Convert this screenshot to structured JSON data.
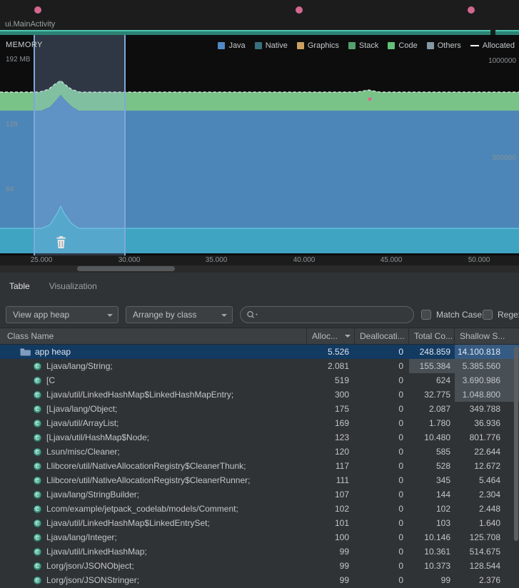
{
  "events_bar": {
    "activity_label": "ui.MainActivity"
  },
  "memory": {
    "title": "MEMORY",
    "max_memory_label": "192 MB",
    "y_axis_left": [
      "128",
      "64"
    ],
    "y_axis_right": [
      "1000000",
      "500000"
    ],
    "legend": [
      {
        "label": "Java",
        "color": "#5289c4"
      },
      {
        "label": "Native",
        "color": "#38707f"
      },
      {
        "label": "Graphics",
        "color": "#cba05f"
      },
      {
        "label": "Stack",
        "color": "#55a06f"
      },
      {
        "label": "Code",
        "color": "#64c17a"
      },
      {
        "label": "Others",
        "color": "#8497a5"
      },
      {
        "label": "Allocated",
        "color": "#ffffff",
        "line": true
      }
    ],
    "timeline_ticks": [
      "25.000",
      "30.000",
      "35.000",
      "40.000",
      "45.000",
      "50.000"
    ]
  },
  "tabs": [
    {
      "label": "Table",
      "active": true
    },
    {
      "label": "Visualization",
      "active": false
    }
  ],
  "controls": {
    "heap_select": "View app heap",
    "arrange_select": "Arrange by class",
    "search_placeholder": "",
    "match_case_label": "Match Case",
    "regex_label": "Regex"
  },
  "table": {
    "columns": [
      "Class Name",
      "Alloc...",
      "Deallocati...",
      "Total Co...",
      "Shallow S..."
    ],
    "sort_column_index": 1,
    "rows": [
      {
        "name": "app heap",
        "icon": "heap-folder",
        "indent": 0,
        "selected": true,
        "alloc": "5.526",
        "dealloc": "0",
        "total": "248.859",
        "shallow": "14.100.818",
        "hl_shallow": true
      },
      {
        "name": "Ljava/lang/String;",
        "icon": "class",
        "indent": 1,
        "alloc": "2.081",
        "dealloc": "0",
        "total": "155.384",
        "shallow": "5.385.560",
        "hl_total": true,
        "hl_shallow": true
      },
      {
        "name": "[C",
        "icon": "class",
        "indent": 1,
        "alloc": "519",
        "dealloc": "0",
        "total": "624",
        "shallow": "3.690.986",
        "hl_shallow": true
      },
      {
        "name": "Ljava/util/LinkedHashMap$LinkedHashMapEntry;",
        "icon": "class",
        "indent": 1,
        "alloc": "300",
        "dealloc": "0",
        "total": "32.775",
        "shallow": "1.048.800",
        "hl_shallow": true
      },
      {
        "name": "[Ljava/lang/Object;",
        "icon": "class",
        "indent": 1,
        "alloc": "175",
        "dealloc": "0",
        "total": "2.087",
        "shallow": "349.788"
      },
      {
        "name": "Ljava/util/ArrayList;",
        "icon": "class",
        "indent": 1,
        "alloc": "169",
        "dealloc": "0",
        "total": "1.780",
        "shallow": "36.936"
      },
      {
        "name": "[Ljava/util/HashMap$Node;",
        "icon": "class",
        "indent": 1,
        "alloc": "123",
        "dealloc": "0",
        "total": "10.480",
        "shallow": "801.776"
      },
      {
        "name": "Lsun/misc/Cleaner;",
        "icon": "class",
        "indent": 1,
        "alloc": "120",
        "dealloc": "0",
        "total": "585",
        "shallow": "22.644"
      },
      {
        "name": "Llibcore/util/NativeAllocationRegistry$CleanerThunk;",
        "icon": "class",
        "indent": 1,
        "alloc": "117",
        "dealloc": "0",
        "total": "528",
        "shallow": "12.672"
      },
      {
        "name": "Llibcore/util/NativeAllocationRegistry$CleanerRunner;",
        "icon": "class",
        "indent": 1,
        "alloc": "111",
        "dealloc": "0",
        "total": "345",
        "shallow": "5.464"
      },
      {
        "name": "Ljava/lang/StringBuilder;",
        "icon": "class",
        "indent": 1,
        "alloc": "107",
        "dealloc": "0",
        "total": "144",
        "shallow": "2.304"
      },
      {
        "name": "Lcom/example/jetpack_codelab/models/Comment;",
        "icon": "class",
        "indent": 1,
        "alloc": "102",
        "dealloc": "0",
        "total": "102",
        "shallow": "2.448"
      },
      {
        "name": "Ljava/util/LinkedHashMap$LinkedEntrySet;",
        "icon": "class",
        "indent": 1,
        "alloc": "101",
        "dealloc": "0",
        "total": "103",
        "shallow": "1.640"
      },
      {
        "name": "Ljava/lang/Integer;",
        "icon": "class",
        "indent": 1,
        "alloc": "100",
        "dealloc": "0",
        "total": "10.146",
        "shallow": "125.708"
      },
      {
        "name": "Ljava/util/LinkedHashMap;",
        "icon": "class",
        "indent": 1,
        "alloc": "99",
        "dealloc": "0",
        "total": "10.361",
        "shallow": "514.675"
      },
      {
        "name": "Lorg/json/JSONObject;",
        "icon": "class",
        "indent": 1,
        "alloc": "99",
        "dealloc": "0",
        "total": "10.373",
        "shallow": "128.544"
      },
      {
        "name": "Lorg/json/JSONStringer;",
        "icon": "class",
        "indent": 1,
        "alloc": "99",
        "dealloc": "0",
        "total": "99",
        "shallow": "2.376"
      }
    ]
  }
}
